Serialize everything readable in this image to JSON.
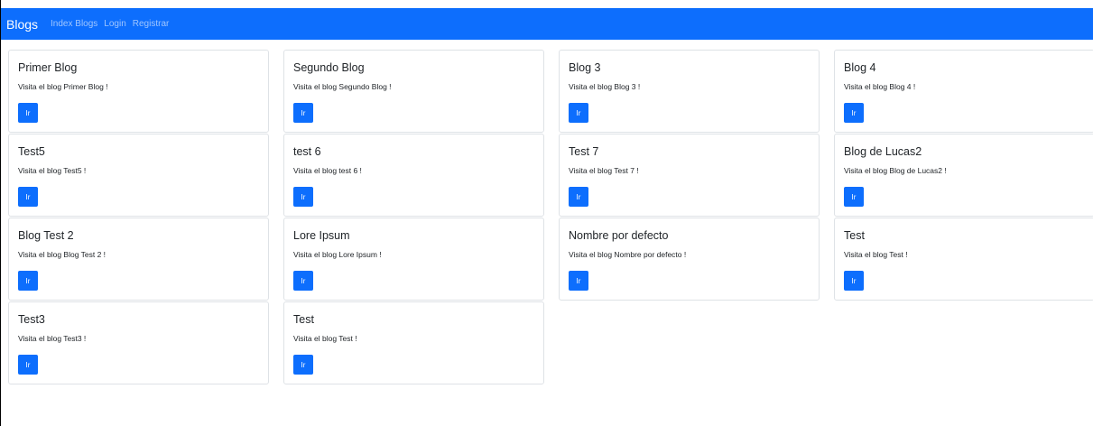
{
  "navbar": {
    "brand": "Blogs",
    "links": [
      "Index Blogs",
      "Login",
      "Registrar"
    ]
  },
  "cards": [
    {
      "title": "Primer Blog",
      "text": "Visita el blog Primer Blog !",
      "button": "Ir"
    },
    {
      "title": "Segundo Blog",
      "text": "Visita el blog Segundo Blog !",
      "button": "Ir"
    },
    {
      "title": "Blog 3",
      "text": "Visita el blog Blog 3 !",
      "button": "Ir"
    },
    {
      "title": "Blog 4",
      "text": "Visita el blog Blog 4 !",
      "button": "Ir"
    },
    {
      "title": "Test5",
      "text": "Visita el blog Test5 !",
      "button": "Ir"
    },
    {
      "title": "test 6",
      "text": "Visita el blog test 6 !",
      "button": "Ir"
    },
    {
      "title": "Test 7",
      "text": "Visita el blog Test 7 !",
      "button": "Ir"
    },
    {
      "title": "Blog de Lucas2",
      "text": "Visita el blog Blog de Lucas2 !",
      "button": "Ir"
    },
    {
      "title": "Blog Test 2",
      "text": "Visita el blog Blog Test 2 !",
      "button": "Ir"
    },
    {
      "title": "Lore Ipsum",
      "text": "Visita el blog Lore Ipsum !",
      "button": "Ir"
    },
    {
      "title": "Nombre por defecto",
      "text": "Visita el blog Nombre por defecto !",
      "button": "Ir"
    },
    {
      "title": "Test",
      "text": "Visita el blog Test !",
      "button": "Ir"
    },
    {
      "title": "Test3",
      "text": "Visita el blog Test3 !",
      "button": "Ir"
    },
    {
      "title": "Test",
      "text": "Visita el blog Test !",
      "button": "Ir"
    }
  ],
  "colors": {
    "navbar_bg": "#0d6efd",
    "button_bg": "#0d6efd",
    "card_border": "#dee2e6"
  }
}
